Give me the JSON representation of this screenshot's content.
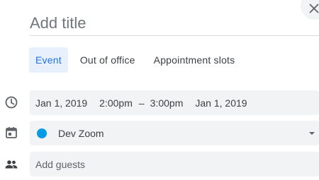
{
  "title_field": {
    "placeholder": "Add title",
    "value": ""
  },
  "tabs": [
    {
      "label": "Event",
      "active": true
    },
    {
      "label": "Out of office",
      "active": false
    },
    {
      "label": "Appointment slots",
      "active": false
    }
  ],
  "datetime": {
    "icon": "clock-icon",
    "start_date": "Jan 1, 2019",
    "start_time": "2:00pm",
    "separator": "–",
    "end_time": "3:00pm",
    "end_date": "Jan 1, 2019"
  },
  "calendar": {
    "icon": "calendar-icon",
    "name": "Dev Zoom",
    "color": "#039be5"
  },
  "guests": {
    "icon": "people-icon",
    "placeholder": "Add guests",
    "value": ""
  },
  "close": {
    "icon": "close-icon"
  },
  "colors": {
    "accent": "#1a73e8",
    "tab_active_bg": "#e8f0fe",
    "field_bg": "#f1f3f4"
  }
}
